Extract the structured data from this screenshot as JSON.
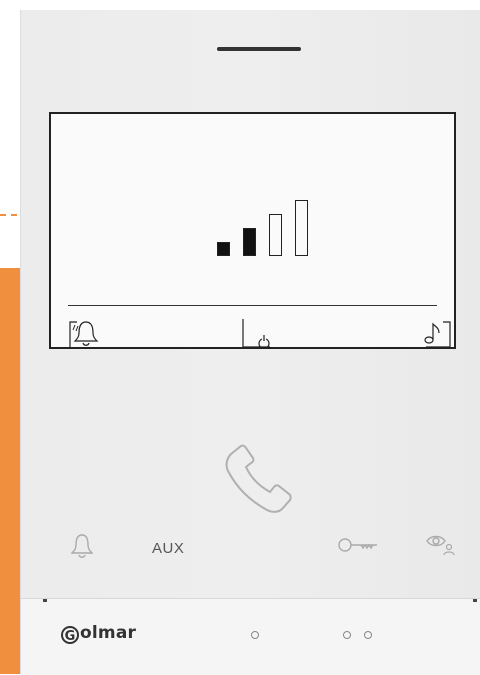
{
  "device": {
    "brand": "olmar",
    "brand_initial": "G",
    "signal_level": 2,
    "signal_max": 4,
    "softkeys": [
      "auto-answer-bell-icon",
      "power-icon",
      "music-note-icon"
    ],
    "buttons": {
      "left_icon": "bell-icon",
      "aux_label": "AUX",
      "key_icon": "key-icon",
      "eye_icon": "monitor-eye-icon"
    },
    "leds": 3
  },
  "colors": {
    "accent": "#f0903f",
    "panel": "#eeeeee",
    "screen": "#fafafa",
    "ink": "#111111"
  }
}
